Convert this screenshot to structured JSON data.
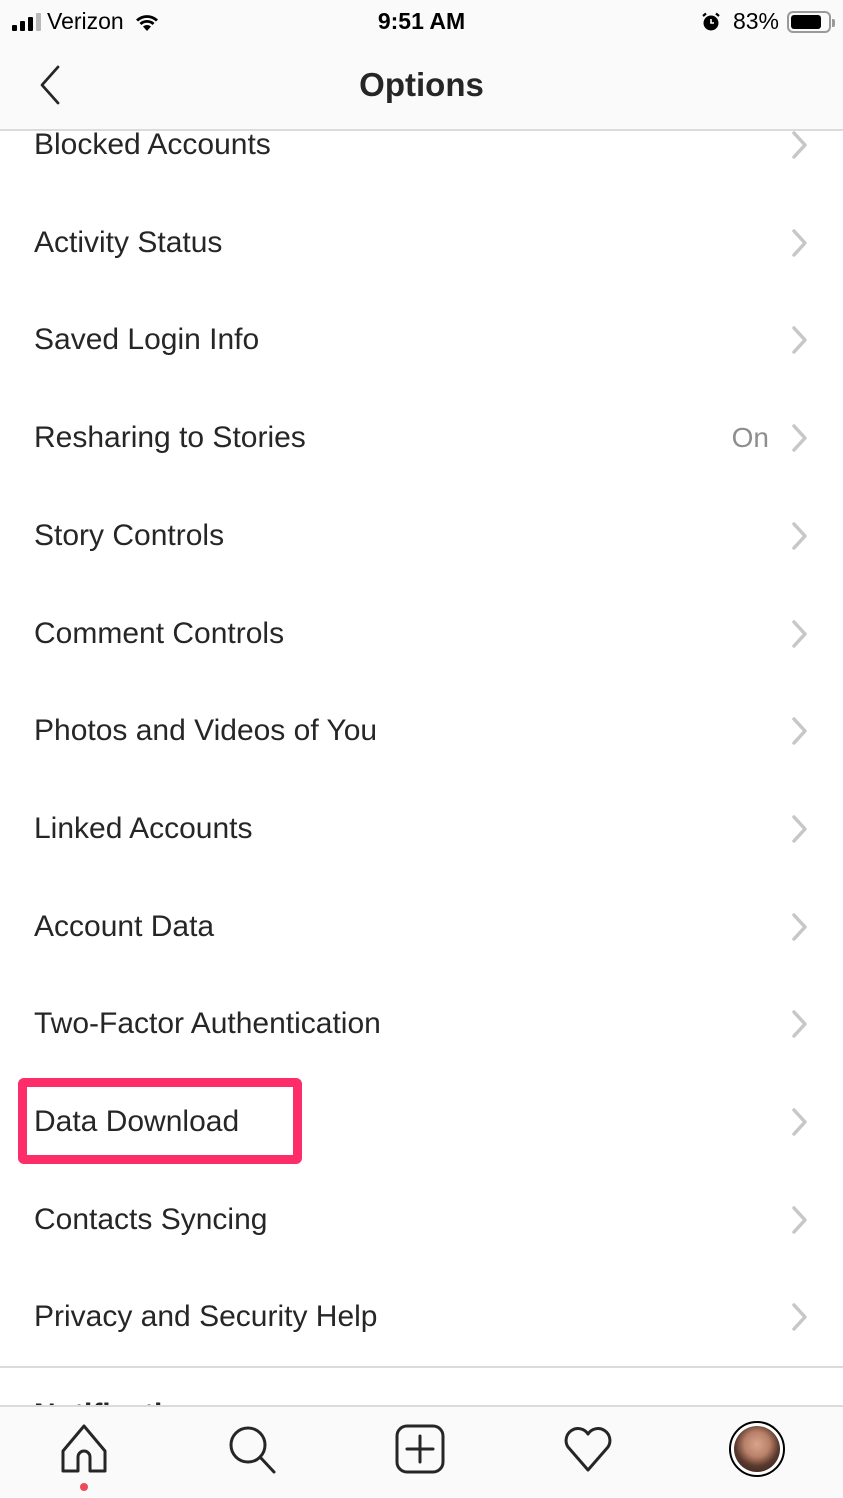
{
  "status_bar": {
    "carrier": "Verizon",
    "time": "9:51 AM",
    "battery_percent": "83%",
    "battery_level": 0.83,
    "icons": [
      "signal-icon",
      "wifi-icon",
      "alarm-icon",
      "battery-icon"
    ]
  },
  "nav": {
    "title": "Options",
    "back_icon": "chevron-left-icon"
  },
  "list": {
    "items": [
      {
        "label": "Blocked Accounts",
        "value": ""
      },
      {
        "label": "Activity Status",
        "value": ""
      },
      {
        "label": "Saved Login Info",
        "value": ""
      },
      {
        "label": "Resharing to Stories",
        "value": "On"
      },
      {
        "label": "Story Controls",
        "value": ""
      },
      {
        "label": "Comment Controls",
        "value": ""
      },
      {
        "label": "Photos and Videos of You",
        "value": ""
      },
      {
        "label": "Linked Accounts",
        "value": ""
      },
      {
        "label": "Account Data",
        "value": ""
      },
      {
        "label": "Two-Factor Authentication",
        "value": ""
      },
      {
        "label": "Data Download",
        "value": "",
        "highlighted": true
      },
      {
        "label": "Contacts Syncing",
        "value": ""
      },
      {
        "label": "Privacy and Security Help",
        "value": ""
      }
    ],
    "next_section_header": "Notifications"
  },
  "highlight_color": "#fd2d69",
  "tab_bar": {
    "tabs": [
      {
        "name": "home",
        "icon": "home-icon",
        "active": true
      },
      {
        "name": "search",
        "icon": "search-icon"
      },
      {
        "name": "new-post",
        "icon": "plus-square-icon"
      },
      {
        "name": "activity",
        "icon": "heart-icon"
      },
      {
        "name": "profile",
        "icon": "avatar"
      }
    ],
    "notification_dot_color": "#ed4956"
  }
}
